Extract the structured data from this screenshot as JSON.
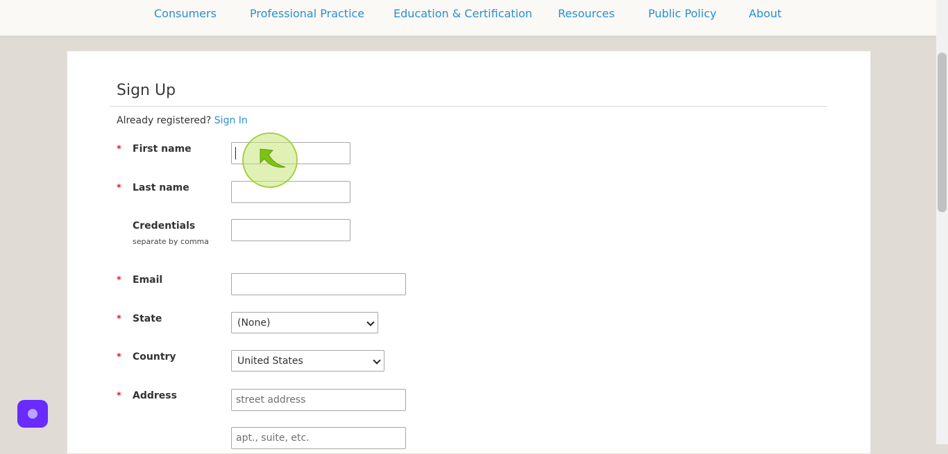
{
  "nav": {
    "items": [
      {
        "label": "Consumers"
      },
      {
        "label": "Professional Practice"
      },
      {
        "label": "Education & Certification"
      },
      {
        "label": "Resources"
      },
      {
        "label": "Public Policy"
      },
      {
        "label": "About"
      }
    ]
  },
  "form": {
    "title": "Sign Up",
    "already_text": "Already registered?",
    "signin_link": "Sign In",
    "required_marker": "*",
    "fields": {
      "first_name": {
        "label": "First name",
        "value": ""
      },
      "last_name": {
        "label": "Last name",
        "value": ""
      },
      "credentials": {
        "label": "Credentials",
        "hint": "separate by comma",
        "value": ""
      },
      "email": {
        "label": "Email",
        "value": ""
      },
      "state": {
        "label": "State",
        "selected": "(None)"
      },
      "country": {
        "label": "Country",
        "selected": "United States"
      },
      "address": {
        "label": "Address",
        "placeholder": "street address",
        "value": ""
      },
      "address2": {
        "placeholder": "apt., suite, etc.",
        "value": ""
      }
    }
  },
  "icons": {
    "chat": "chat-bubble-icon",
    "cursor": "click-cursor-icon"
  },
  "colors": {
    "link": "#2a8fd0",
    "required": "#e0202a",
    "chat_button": "#6a2bff"
  }
}
